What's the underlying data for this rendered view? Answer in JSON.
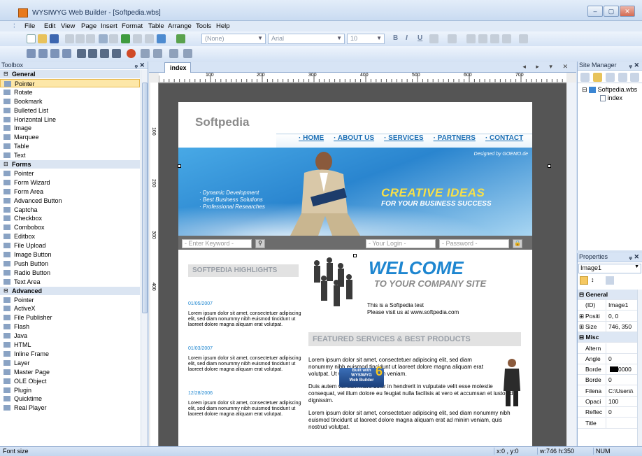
{
  "window": {
    "title": "WYSIWYG Web Builder - [Softpedia.wbs]"
  },
  "menu": [
    "File",
    "Edit",
    "View",
    "Page",
    "Insert",
    "Format",
    "Table",
    "Arrange",
    "Tools",
    "Help"
  ],
  "toolbar": {
    "style_combo": "(None)",
    "font_combo": "Arial",
    "size_combo": "10",
    "bold": "B",
    "italic": "I",
    "underline": "U"
  },
  "toolbox": {
    "title": "Toolbox",
    "items": [
      {
        "label": "General",
        "cat": true
      },
      {
        "label": "Pointer",
        "sel": true
      },
      {
        "label": "Rotate"
      },
      {
        "label": "Bookmark"
      },
      {
        "label": "Bulleted List"
      },
      {
        "label": "Horizontal Line"
      },
      {
        "label": "Image"
      },
      {
        "label": "Marquee"
      },
      {
        "label": "Table"
      },
      {
        "label": "Text"
      },
      {
        "label": "Forms",
        "cat": true
      },
      {
        "label": "Pointer"
      },
      {
        "label": "Form Wizard"
      },
      {
        "label": "Form Area"
      },
      {
        "label": "Advanced Button"
      },
      {
        "label": "Captcha"
      },
      {
        "label": "Checkbox"
      },
      {
        "label": "Combobox"
      },
      {
        "label": "Editbox"
      },
      {
        "label": "File Upload"
      },
      {
        "label": "Image Button"
      },
      {
        "label": "Push Button"
      },
      {
        "label": "Radio Button"
      },
      {
        "label": "Text Area"
      },
      {
        "label": "Advanced",
        "cat": true
      },
      {
        "label": "Pointer"
      },
      {
        "label": "ActiveX"
      },
      {
        "label": "File Publisher"
      },
      {
        "label": "Flash"
      },
      {
        "label": "Java"
      },
      {
        "label": "HTML"
      },
      {
        "label": "Inline Frame"
      },
      {
        "label": "Layer"
      },
      {
        "label": "Master Page"
      },
      {
        "label": "OLE Object"
      },
      {
        "label": "Plugin"
      },
      {
        "label": "Quicktime"
      },
      {
        "label": "Real Player"
      }
    ]
  },
  "editor": {
    "tab": "index",
    "ruler_marks": [
      "100",
      "200",
      "300",
      "400",
      "500",
      "600",
      "700"
    ],
    "vruler_marks": [
      "100",
      "200",
      "300",
      "400"
    ]
  },
  "page": {
    "logo": "Softpedia",
    "nav": [
      "· HOME",
      "· ABOUT US",
      "· SERVICES",
      "· PARTNERS",
      "· CONTACT"
    ],
    "designed": "Designed by GOEMO.de",
    "bullets": [
      "· Dynamic Development",
      "· Best Business Solutions",
      "· Professional Researches"
    ],
    "creative": "CREATIVE IDEAS",
    "creative_sub": "FOR YOUR BUSINESS SUCCESS",
    "search_placeholder": "- Enter Keyword -",
    "login_placeholder": "- Your Login -",
    "password_placeholder": "- Password -",
    "highlights_title": "SOFTPEDIA HIGHLIGHTS",
    "news": [
      {
        "date": "01/05/2007",
        "text": "Lorem ipsum dolor sit amet, consectetuer adipiscing elit, sed diam nonummy nibh euismod tincidunt ut laoreet dolore magna aliquam erat volutpat."
      },
      {
        "date": "01/03/2007",
        "text": "Lorem ipsum dolor sit amet, consectetuer adipiscing elit, sed diam nonummy nibh euismod tincidunt ut laoreet dolore magna aliquam erat volutpat."
      },
      {
        "date": "12/28/2006",
        "text": "Lorem ipsum dolor sit amet, consectetuer adipiscing elit, sed diam nonummy nibh euismod tincidunt ut laoreet dolore magna aliquam erat volutpat."
      }
    ],
    "welcome": "WELCOME",
    "welcome_sub": "TO YOUR COMPANY SITE",
    "test_line1": "This is a Softpedia test",
    "test_line2": "Please visit us at www.softpedia.com",
    "featured_title": "FEATURED SERVICES & BEST PRODUCTS",
    "featured_p1": "Lorem ipsum dolor sit amet, consectetuer adipiscing elit, sed diam nonummy nibh euismod tincidunt ut laoreet dolore magna aliquam erat volutpat. Ut wisi enim ad minim veniam.",
    "featured_p2": "Duis autem vel eum iriure dolor in hendrerit in vulputate velit esse molestie consequat, vel illum dolore eu feugiat nulla facilisis at vero et accumsan et iusto odio dignissim.",
    "featured_p3": "Lorem ipsum dolor sit amet, consectetuer adipiscing elit, sed diam nonummy nibh euismod tincidunt ut laoreet dolore magna aliquam erat ad minim veniam, quis nostrud volutpat.",
    "badge_line1": "Built with",
    "badge_line2": "WYSIWYG",
    "badge_line3": "Web Builder",
    "badge_num": "6"
  },
  "site_manager": {
    "title": "Site Manager",
    "root": "Softpedia.wbs",
    "child": "index"
  },
  "properties": {
    "title": "Properties",
    "object": "Image1",
    "rows": [
      {
        "k": "General",
        "grp": true
      },
      {
        "k": "(ID)",
        "v": "Image1"
      },
      {
        "k": "Positi",
        "v": "0, 0",
        "plus": true
      },
      {
        "k": "Size",
        "v": "746, 350",
        "plus": true
      },
      {
        "k": "Misc",
        "grp": true
      },
      {
        "k": "Altern",
        "v": ""
      },
      {
        "k": "Angle",
        "v": "0"
      },
      {
        "k": "Borde",
        "v": "0000"
      },
      {
        "k": "Borde",
        "v": "0"
      },
      {
        "k": "Filena",
        "v": "C:\\Users\\"
      },
      {
        "k": "Opaci",
        "v": "100"
      },
      {
        "k": "Reflec",
        "v": "0"
      },
      {
        "k": "Title",
        "v": ""
      }
    ]
  },
  "status": {
    "left": "Font size",
    "coords": "x:0 , y:0",
    "size": "w:746 h:350",
    "num": "NUM"
  }
}
